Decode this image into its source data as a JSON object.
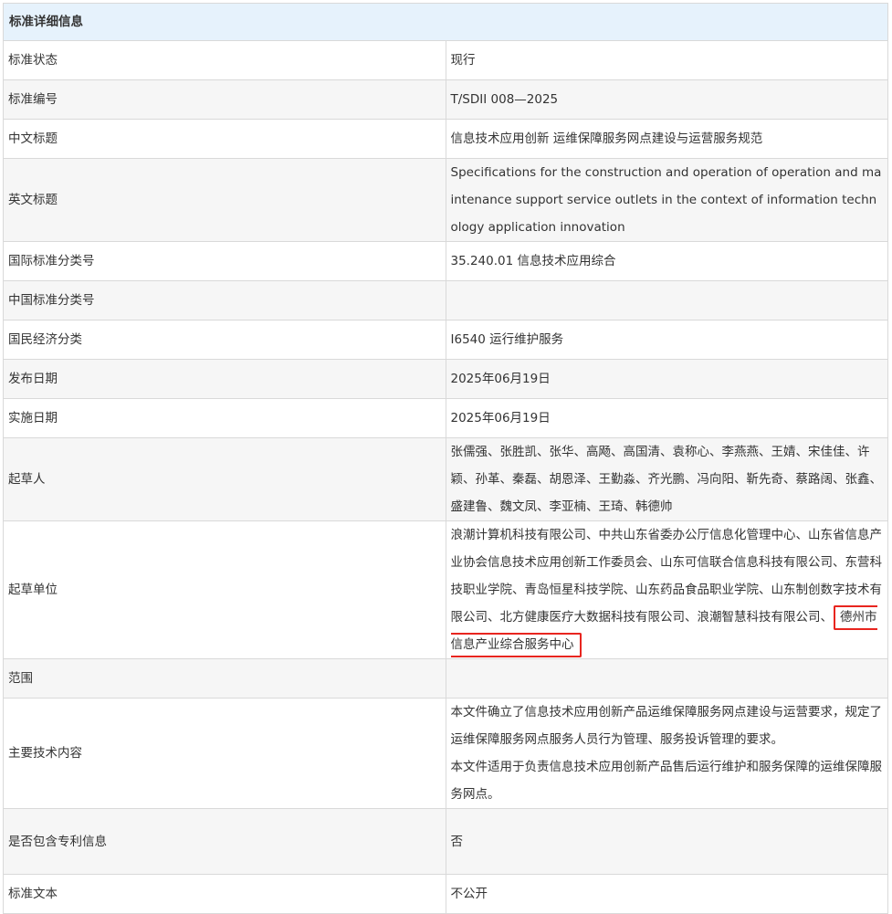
{
  "header": {
    "title": "标准详细信息"
  },
  "rows": {
    "status": {
      "label": "标准状态",
      "value": "现行"
    },
    "number": {
      "label": "标准编号",
      "value": "T/SDII 008—2025"
    },
    "cn_title": {
      "label": "中文标题",
      "value": "信息技术应用创新 运维保障服务网点建设与运营服务规范"
    },
    "en_title": {
      "label": "英文标题",
      "value": "Specifications for the construction and operation of operation and maintenance support service outlets in the context of information technology application innovation"
    },
    "ics": {
      "label": "国际标准分类号",
      "value": "35.240.01 信息技术应用综合"
    },
    "ccs": {
      "label": "中国标准分类号",
      "value": ""
    },
    "economy": {
      "label": "国民经济分类",
      "value": "I6540 运行维护服务"
    },
    "publish_date": {
      "label": "发布日期",
      "value": "2025年06月19日"
    },
    "effective_date": {
      "label": "实施日期",
      "value": "2025年06月19日"
    },
    "drafters": {
      "label": "起草人",
      "value": "张儒强、张胜凯、张华、高飏、高国清、袁称心、李燕燕、王婧、宋佳佳、许颖、孙革、秦磊、胡恩泽、王勤淼、齐光鹏、冯向阳、靳先奇、蔡路阔、张鑫、盛建鲁、魏文凤、李亚楠、王琦、韩德帅"
    },
    "units": {
      "label": "起草单位",
      "value_main": "浪潮计算机科技有限公司、中共山东省委办公厅信息化管理中心、山东省信息产业协会信息技术应用创新工作委员会、山东可信联合信息科技有限公司、东营科技职业学院、青岛恒星科技学院、山东药品食品职业学院、山东制创数字技术有限公司、北方健康医疗大数据科技有限公司、浪潮智慧科技有限公司、",
      "value_highlight": "德州市信息产业综合服务中心"
    },
    "scope": {
      "label": "范围",
      "value": ""
    },
    "tech": {
      "label": "主要技术内容",
      "value_p1": "本文件确立了信息技术应用创新产品运维保障服务网点建设与运营要求，规定了运维保障服务网点服务人员行为管理、服务投诉管理的要求。",
      "value_p2": "本文件适用于负责信息技术应用创新产品售后运行维护和服务保障的运维保障服务网点。"
    },
    "patent": {
      "label": "是否包含专利信息",
      "value": "否"
    },
    "text": {
      "label": "标准文本",
      "value": "不公开"
    }
  },
  "colors": {
    "header_bg": "#e6f2fc",
    "row_alt_bg": "#f6f6f6",
    "border": "#d9d9d9",
    "highlight": "#e8251f"
  }
}
